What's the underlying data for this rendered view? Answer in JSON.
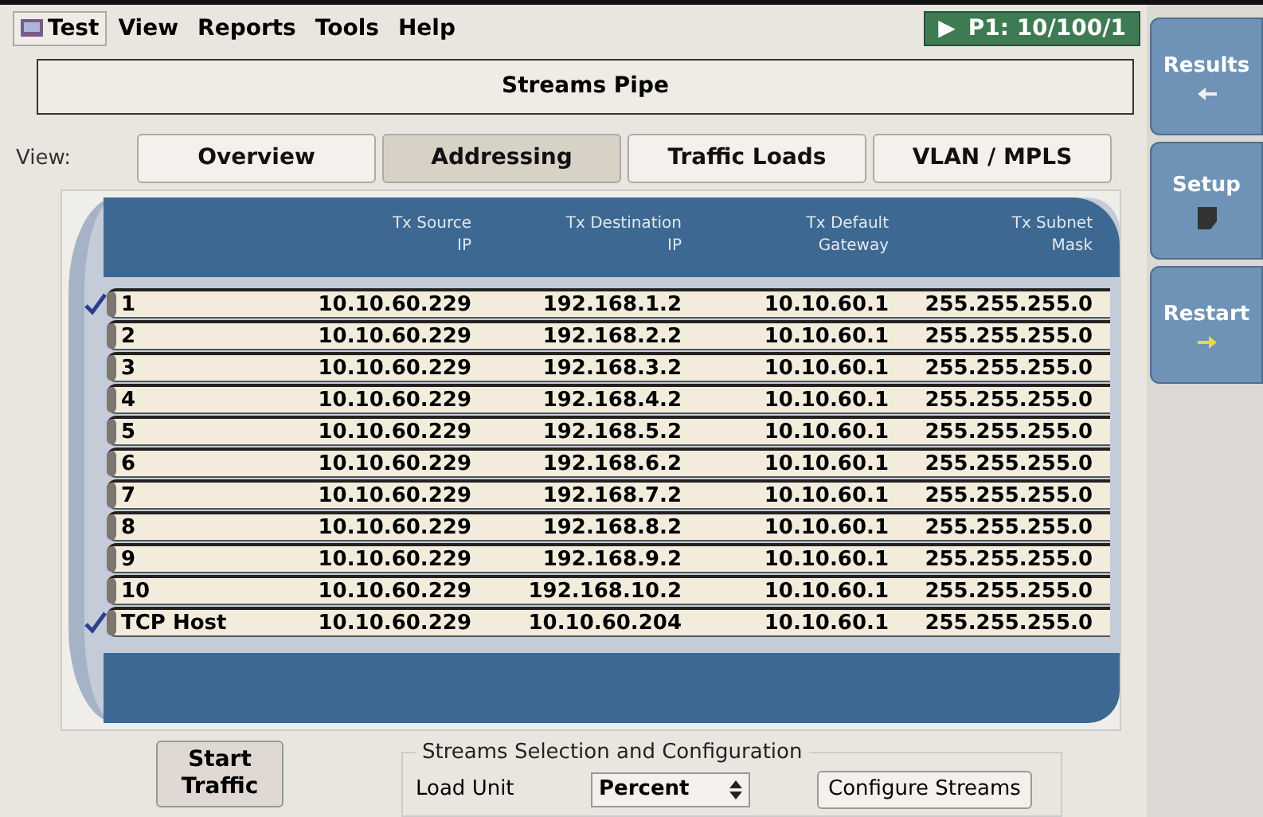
{
  "menu": [
    {
      "label": "Test",
      "selected": true
    },
    {
      "label": "View",
      "selected": false
    },
    {
      "label": "Reports",
      "selected": false
    },
    {
      "label": "Tools",
      "selected": false
    },
    {
      "label": "Help",
      "selected": false
    }
  ],
  "port_status": {
    "label": "P1: 10/100/1",
    "icon": "▶"
  },
  "title": "Streams Pipe",
  "view": {
    "label": "View:",
    "tabs": [
      {
        "label": "Overview",
        "selected": false
      },
      {
        "label": "Addressing",
        "selected": true
      },
      {
        "label": "Traffic Loads",
        "selected": false
      },
      {
        "label": "VLAN / MPLS",
        "selected": false
      }
    ]
  },
  "table": {
    "columns": [
      {
        "line1": "Tx Source",
        "line2": "IP"
      },
      {
        "line1": "Tx Destination",
        "line2": "IP"
      },
      {
        "line1": "Tx Default",
        "line2": "Gateway"
      },
      {
        "line1": "Tx Subnet",
        "line2": "Mask"
      }
    ],
    "rows": [
      {
        "name": "1",
        "checked": true,
        "cells": [
          "10.10.60.229",
          "192.168.1.2",
          "10.10.60.1",
          "255.255.255.0"
        ]
      },
      {
        "name": "2",
        "checked": false,
        "cells": [
          "10.10.60.229",
          "192.168.2.2",
          "10.10.60.1",
          "255.255.255.0"
        ]
      },
      {
        "name": "3",
        "checked": false,
        "cells": [
          "10.10.60.229",
          "192.168.3.2",
          "10.10.60.1",
          "255.255.255.0"
        ]
      },
      {
        "name": "4",
        "checked": false,
        "cells": [
          "10.10.60.229",
          "192.168.4.2",
          "10.10.60.1",
          "255.255.255.0"
        ]
      },
      {
        "name": "5",
        "checked": false,
        "cells": [
          "10.10.60.229",
          "192.168.5.2",
          "10.10.60.1",
          "255.255.255.0"
        ]
      },
      {
        "name": "6",
        "checked": false,
        "cells": [
          "10.10.60.229",
          "192.168.6.2",
          "10.10.60.1",
          "255.255.255.0"
        ]
      },
      {
        "name": "7",
        "checked": false,
        "cells": [
          "10.10.60.229",
          "192.168.7.2",
          "10.10.60.1",
          "255.255.255.0"
        ]
      },
      {
        "name": "8",
        "checked": false,
        "cells": [
          "10.10.60.229",
          "192.168.8.2",
          "10.10.60.1",
          "255.255.255.0"
        ]
      },
      {
        "name": "9",
        "checked": false,
        "cells": [
          "10.10.60.229",
          "192.168.9.2",
          "10.10.60.1",
          "255.255.255.0"
        ]
      },
      {
        "name": "10",
        "checked": false,
        "cells": [
          "10.10.60.229",
          "192.168.10.2",
          "10.10.60.1",
          "255.255.255.0"
        ]
      },
      {
        "name": "TCP Host",
        "checked": true,
        "cells": [
          "10.10.60.229",
          "10.10.60.204",
          "10.10.60.1",
          "255.255.255.0"
        ]
      }
    ]
  },
  "start_button": "Start Traffic",
  "streams_group": {
    "legend": "Streams Selection and Configuration",
    "load_unit_label": "Load Unit",
    "load_unit_value": "Percent",
    "configure_button": "Configure Streams"
  },
  "side_buttons": [
    {
      "label": "Results",
      "kind": "back"
    },
    {
      "label": "Setup",
      "kind": "page"
    },
    {
      "label": "Restart",
      "kind": "go"
    }
  ]
}
